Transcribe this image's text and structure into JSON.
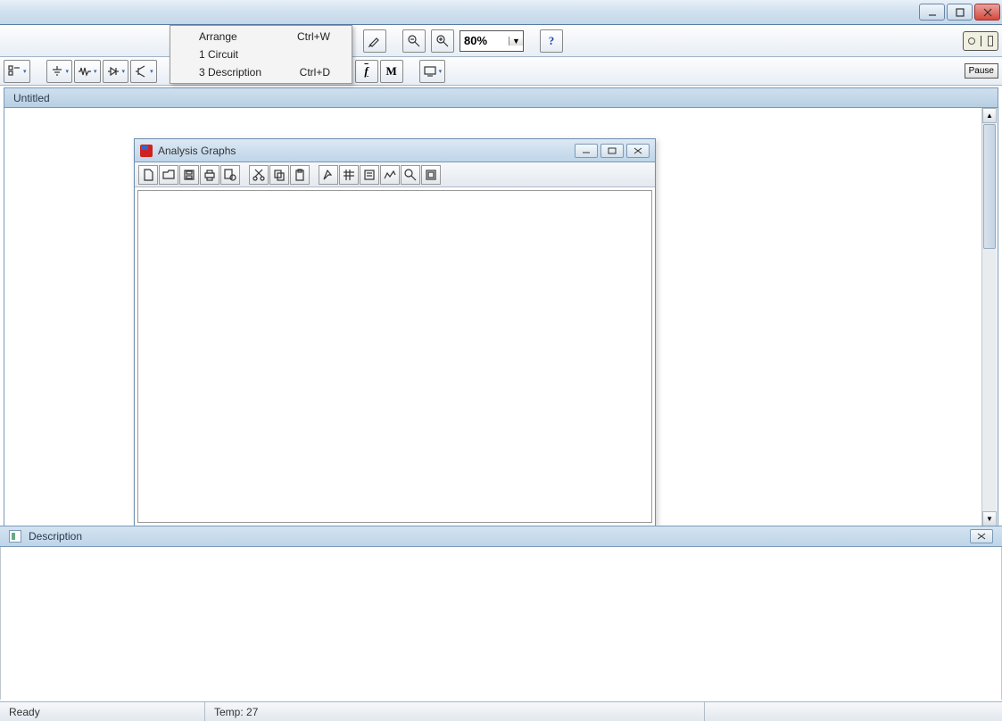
{
  "window": {
    "title": ""
  },
  "menu": {
    "items": [
      {
        "label": "Arrange",
        "accel": "Ctrl+W"
      },
      {
        "label": "1 Circuit",
        "accel": ""
      },
      {
        "label": "3 Description",
        "accel": "Ctrl+D"
      }
    ]
  },
  "toolbar1": {
    "zoom_value": "80%",
    "help_label": "?"
  },
  "toolbar2": {
    "pause_label": "Pause",
    "fbold_label": "f",
    "mbold_label": "M",
    "switch_state": "O I"
  },
  "mdi": {
    "title": "Untitled"
  },
  "analysis": {
    "title": "Analysis Graphs"
  },
  "description": {
    "title": "Description"
  },
  "status": {
    "ready": "Ready",
    "temp_label": "Temp:",
    "temp_value": "27"
  }
}
